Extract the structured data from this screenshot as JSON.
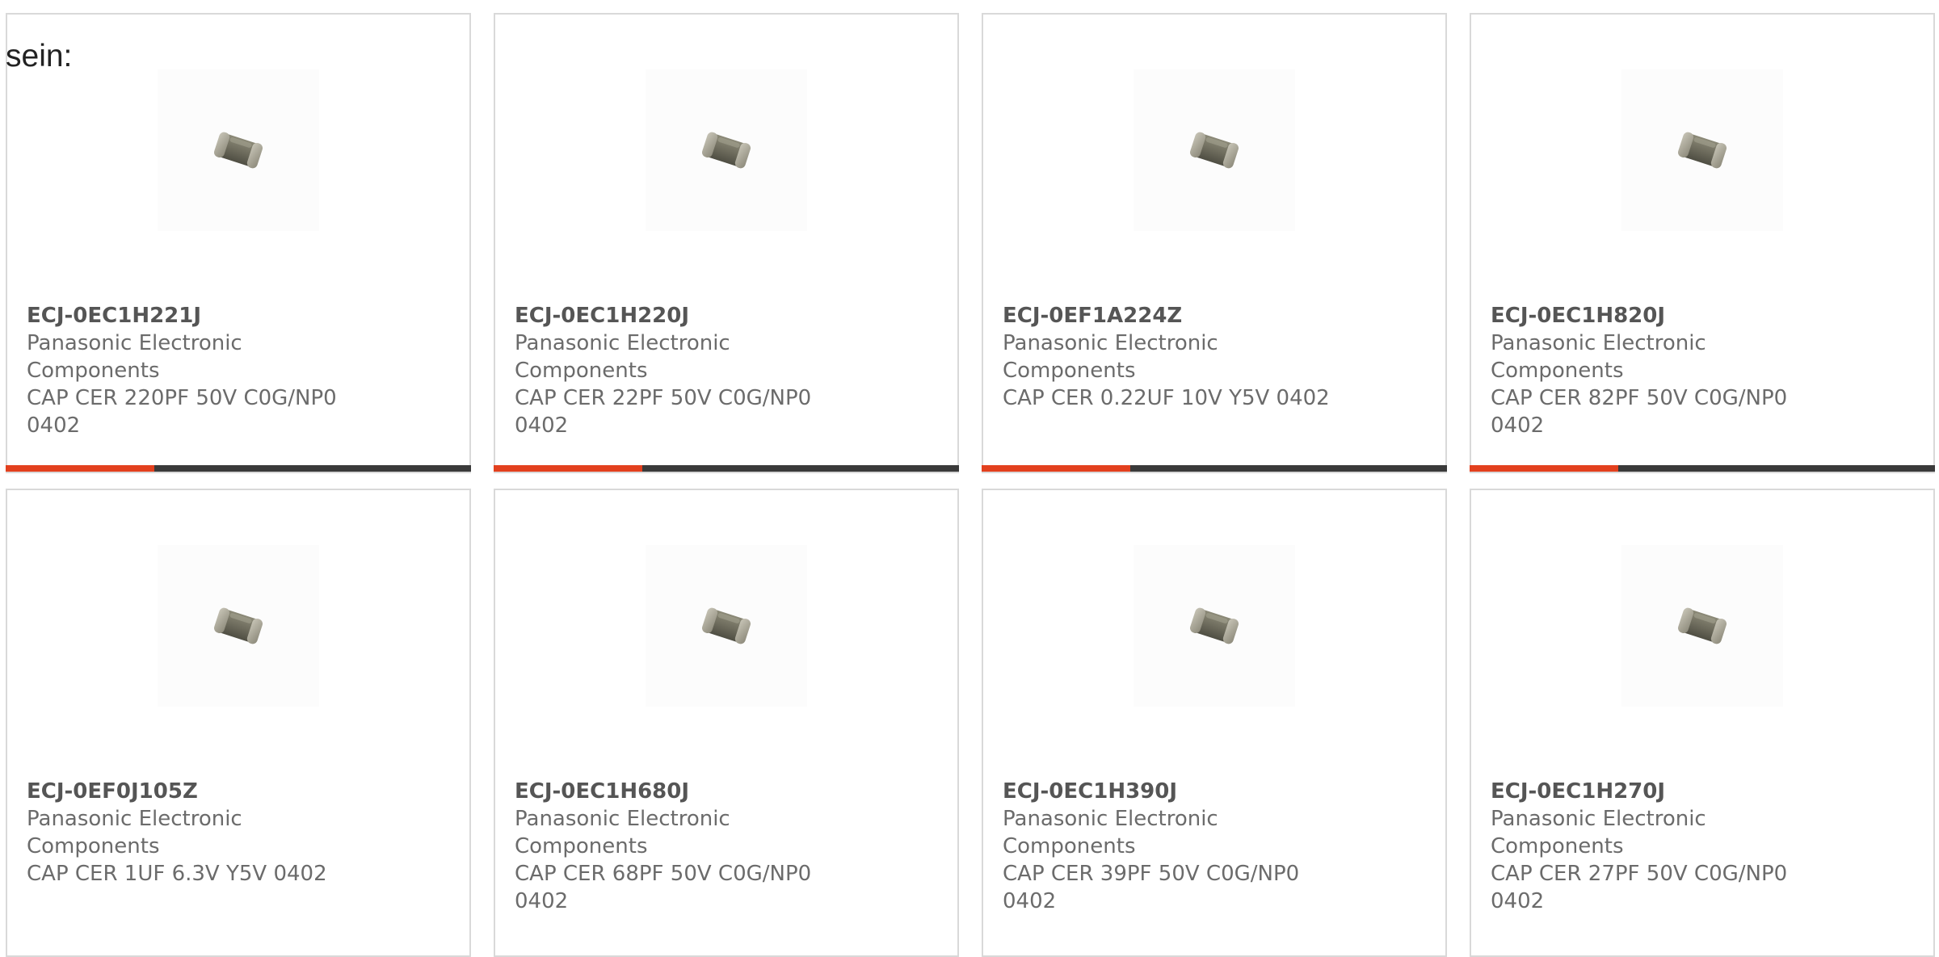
{
  "intro_text": "sein:",
  "accent_color": "#e3401e",
  "progress_track_color": "#3a3a3a",
  "cards": [
    {
      "part_number": "ECJ-0EC1H221J",
      "manufacturer": "Panasonic Electronic Components",
      "description": "CAP CER 220PF 50V C0G/NP0 0402",
      "image_icon": "ceramic-capacitor-icon",
      "progress": 0.32
    },
    {
      "part_number": "ECJ-0EC1H220J",
      "manufacturer": "Panasonic Electronic Components",
      "description": "CAP CER 22PF 50V C0G/NP0 0402",
      "image_icon": "ceramic-capacitor-icon",
      "progress": 0.32
    },
    {
      "part_number": "ECJ-0EF1A224Z",
      "manufacturer": "Panasonic Electronic Components",
      "description": "CAP CER 0.22UF 10V Y5V 0402",
      "image_icon": "ceramic-capacitor-icon",
      "progress": 0.32
    },
    {
      "part_number": "ECJ-0EC1H820J",
      "manufacturer": "Panasonic Electronic Components",
      "description": "CAP CER 82PF 50V C0G/NP0 0402",
      "image_icon": "ceramic-capacitor-icon",
      "progress": 0.32
    },
    {
      "part_number": "ECJ-0EF0J105Z",
      "manufacturer": "Panasonic Electronic Components",
      "description": "CAP CER 1UF 6.3V Y5V 0402",
      "image_icon": "ceramic-capacitor-icon"
    },
    {
      "part_number": "ECJ-0EC1H680J",
      "manufacturer": "Panasonic Electronic Components",
      "description": "CAP CER 68PF 50V C0G/NP0 0402",
      "image_icon": "ceramic-capacitor-icon"
    },
    {
      "part_number": "ECJ-0EC1H390J",
      "manufacturer": "Panasonic Electronic Components",
      "description": "CAP CER 39PF 50V C0G/NP0 0402",
      "image_icon": "ceramic-capacitor-icon"
    },
    {
      "part_number": "ECJ-0EC1H270J",
      "manufacturer": "Panasonic Electronic Components",
      "description": "CAP CER 27PF 50V C0G/NP0 0402",
      "image_icon": "ceramic-capacitor-icon"
    }
  ]
}
